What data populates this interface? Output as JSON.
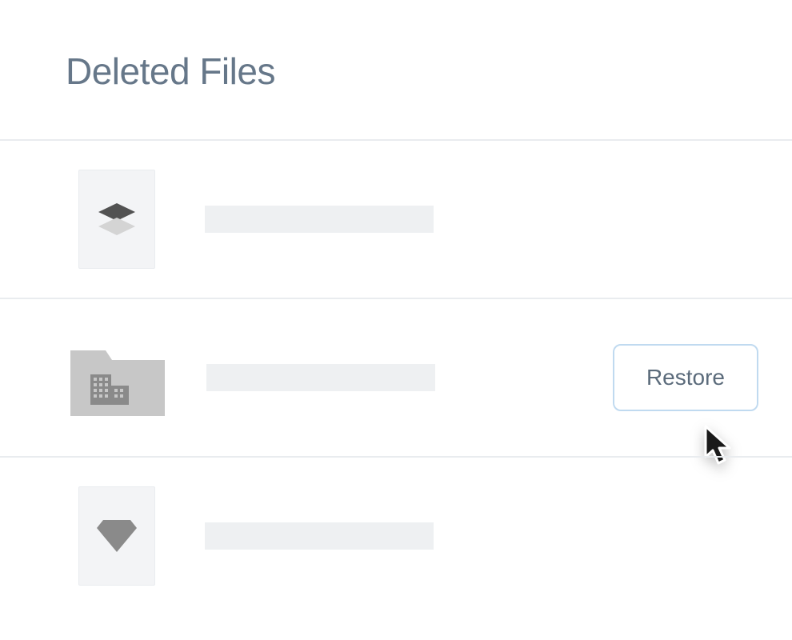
{
  "page": {
    "title": "Deleted Files"
  },
  "items": [
    {
      "icon": "layers",
      "name_placeholder": true,
      "show_restore": false
    },
    {
      "icon": "team-folder",
      "name_placeholder": true,
      "show_restore": true
    },
    {
      "icon": "diamond",
      "name_placeholder": true,
      "show_restore": false
    }
  ],
  "actions": {
    "restore_label": "Restore"
  }
}
